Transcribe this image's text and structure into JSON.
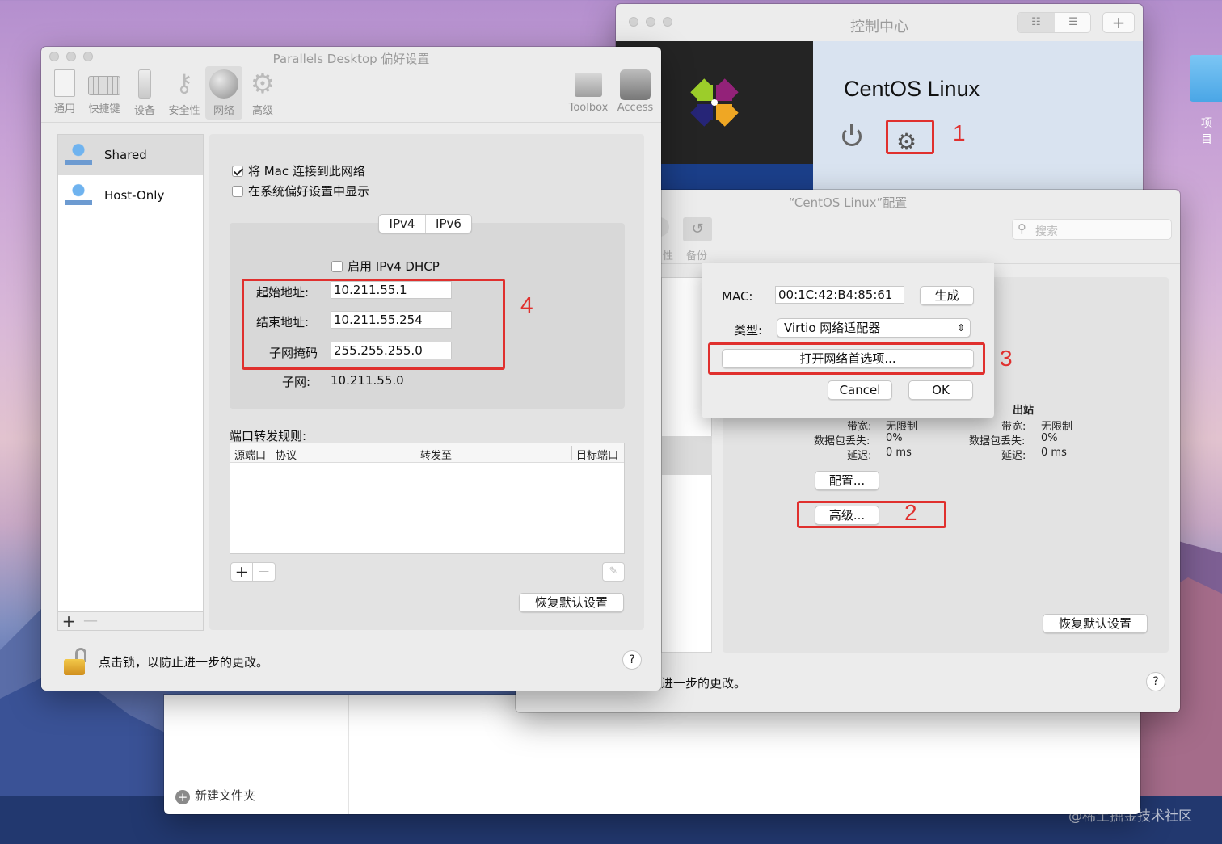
{
  "desktop": {
    "folder_label": "项目",
    "watermark": "@稀土掘金技术社区"
  },
  "finder": {
    "new_folder": "新建文件夹"
  },
  "control_center": {
    "title": "控制中心",
    "vm_name": "CentOS Linux",
    "callout": "1"
  },
  "prefs": {
    "title": "Parallels Desktop 偏好设置",
    "toolbar": [
      {
        "label": "通用",
        "icon": "general-icon"
      },
      {
        "label": "快捷键",
        "icon": "keyboard-icon"
      },
      {
        "label": "设备",
        "icon": "device-icon"
      },
      {
        "label": "安全性",
        "icon": "key-icon"
      },
      {
        "label": "网络",
        "icon": "globe-icon"
      },
      {
        "label": "高级",
        "icon": "gear-icon"
      }
    ],
    "toolbar_right": [
      {
        "label": "Toolbox",
        "icon": "toolbox-icon"
      },
      {
        "label": "Access",
        "icon": "access-icon"
      }
    ],
    "networks": [
      "Shared",
      "Host-Only"
    ],
    "connect_mac": "将 Mac 连接到此网络",
    "show_in_prefs": "在系统偏好设置中显示",
    "seg": [
      "IPv4",
      "IPv6"
    ],
    "dhcp": "启用 IPv4 DHCP",
    "start_label": "起始地址:",
    "start_value": "10.211.55.1",
    "end_label": "结束地址:",
    "end_value": "10.211.55.254",
    "mask_label": "子网掩码",
    "mask_value": "255.255.255.0",
    "subnet_label": "子网:",
    "subnet_value": "10.211.55.0",
    "callout": "4",
    "port_rules": "端口转发规则:",
    "cols": [
      "源端口",
      "协议",
      "转发至",
      "目标端口"
    ],
    "restore": "恢复默认设置",
    "lock_text": "点击锁，以防止进一步的更改。",
    "help": "?"
  },
  "config": {
    "title": "“CentOS Linux”配置",
    "search_placeholder": "搜索",
    "tb_partial": "性",
    "tb_backup": "备份",
    "outbound": "出站",
    "stats": [
      {
        "label": "带宽:",
        "in": "无限制",
        "out": "无限制"
      },
      {
        "label": "数据包丢失:",
        "in": "0%",
        "out": "0%"
      },
      {
        "label": "延迟:",
        "in": "0 ms",
        "out": "0 ms"
      }
    ],
    "configure_btn": "配置...",
    "advanced_btn": "高级...",
    "callout_2": "2",
    "restore": "恢复默认设置",
    "lock_text_partial": "进一步的更改。",
    "help": "?"
  },
  "sheet": {
    "mac_label": "MAC:",
    "mac_value": "00:1C:42:B4:85:61",
    "generate": "生成",
    "type_label": "类型:",
    "type_value": "Virtio 网络适配器",
    "open_prefs": "打开网络首选项...",
    "callout": "3",
    "cancel": "Cancel",
    "ok": "OK"
  }
}
